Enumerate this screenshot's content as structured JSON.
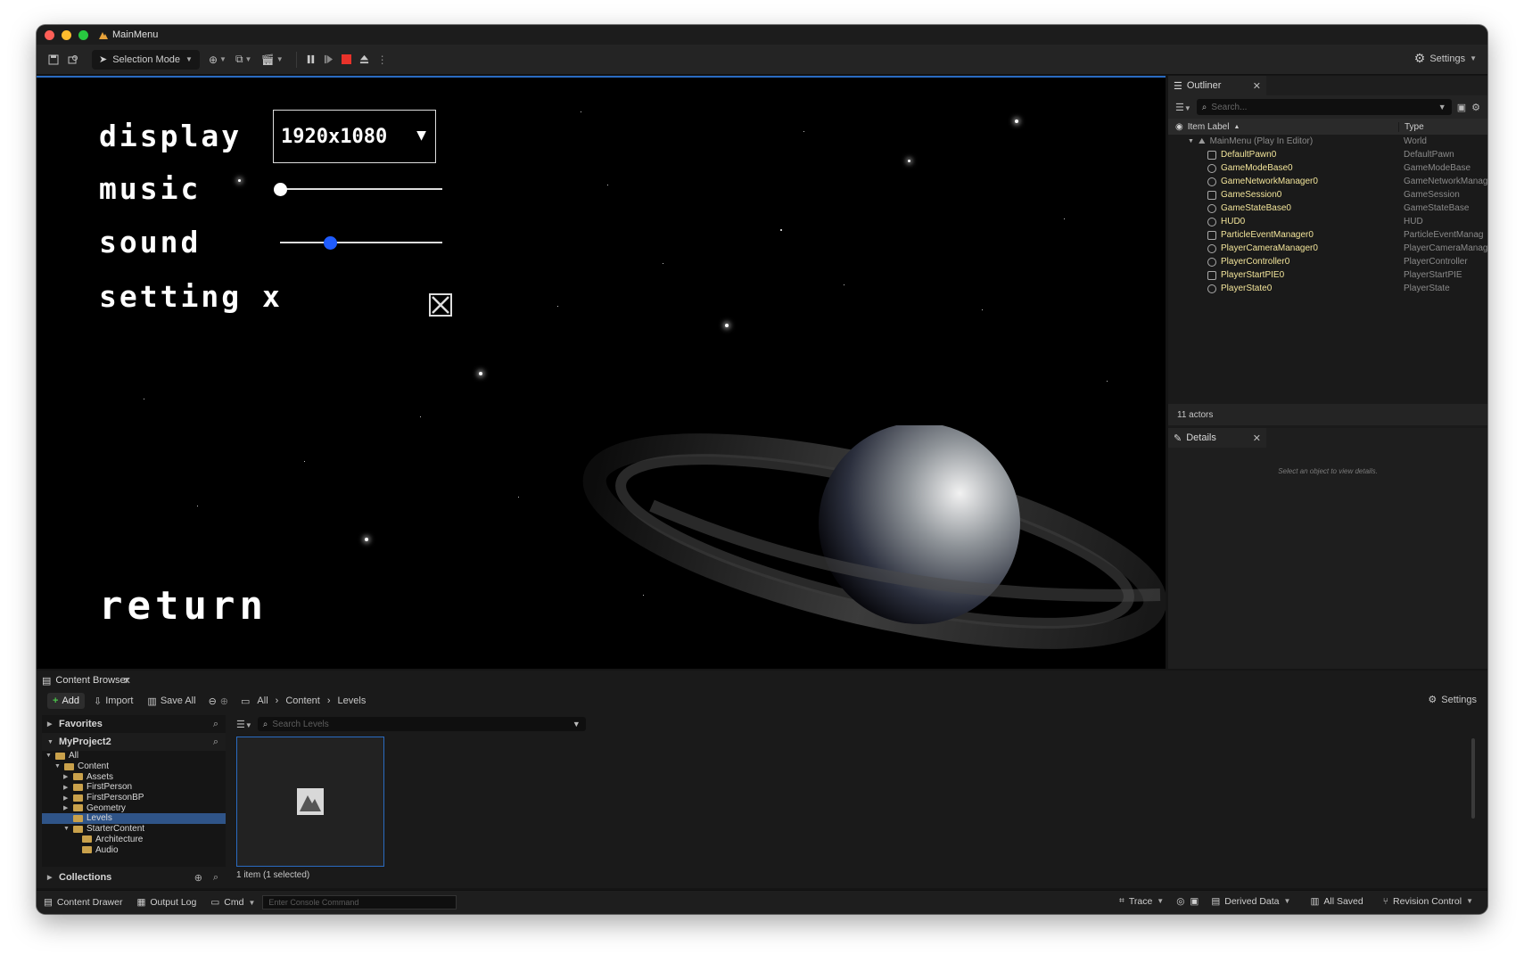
{
  "window": {
    "title": "MainMenu"
  },
  "toolbar": {
    "selection_mode_label": "Selection Mode",
    "settings_label": "Settings"
  },
  "game_menu": {
    "display_label": "display",
    "display_value": "1920x1080",
    "music_label": "music",
    "music_level": 0.0,
    "sound_label": "sound",
    "sound_level": 0.31,
    "setting_x_label": "setting x",
    "setting_x_checked": true,
    "return_label": "return"
  },
  "outliner": {
    "tab_label": "Outliner",
    "search_placeholder": "Search...",
    "col_label": "Item Label",
    "col_type": "Type",
    "world_row": {
      "label": "MainMenu (Play In Editor)",
      "type": "World"
    },
    "rows": [
      {
        "label": "DefaultPawn0",
        "type": "DefaultPawn"
      },
      {
        "label": "GameModeBase0",
        "type": "GameModeBase"
      },
      {
        "label": "GameNetworkManager0",
        "type": "GameNetworkManag"
      },
      {
        "label": "GameSession0",
        "type": "GameSession"
      },
      {
        "label": "GameStateBase0",
        "type": "GameStateBase"
      },
      {
        "label": "HUD0",
        "type": "HUD"
      },
      {
        "label": "ParticleEventManager0",
        "type": "ParticleEventManag"
      },
      {
        "label": "PlayerCameraManager0",
        "type": "PlayerCameraManag"
      },
      {
        "label": "PlayerController0",
        "type": "PlayerController"
      },
      {
        "label": "PlayerStartPIE0",
        "type": "PlayerStartPIE"
      },
      {
        "label": "PlayerState0",
        "type": "PlayerState"
      }
    ],
    "actors_count": "11 actors"
  },
  "details": {
    "tab_label": "Details",
    "hint": "Select an object to view details."
  },
  "content_browser": {
    "tab_label": "Content Browser",
    "add_label": "Add",
    "import_label": "Import",
    "save_all_label": "Save All",
    "breadcrumb": [
      "All",
      "Content",
      "Levels"
    ],
    "settings_label": "Settings",
    "favorites_label": "Favorites",
    "project_label": "MyProject2",
    "tree": [
      {
        "label": "All",
        "depth": 0,
        "open": true
      },
      {
        "label": "Content",
        "depth": 1,
        "open": true
      },
      {
        "label": "Assets",
        "depth": 2,
        "open": false
      },
      {
        "label": "FirstPerson",
        "depth": 2,
        "open": false
      },
      {
        "label": "FirstPersonBP",
        "depth": 2,
        "open": false
      },
      {
        "label": "Geometry",
        "depth": 2,
        "open": false
      },
      {
        "label": "Levels",
        "depth": 2,
        "open": null,
        "selected": true
      },
      {
        "label": "StarterContent",
        "depth": 2,
        "open": true
      },
      {
        "label": "Architecture",
        "depth": 3,
        "open": null
      },
      {
        "label": "Audio",
        "depth": 3,
        "open": null
      }
    ],
    "collections_label": "Collections",
    "search_placeholder": "Search Levels",
    "status": "1 item (1 selected)"
  },
  "statusbar": {
    "content_drawer": "Content Drawer",
    "output_log": "Output Log",
    "cmd": "Cmd",
    "console_placeholder": "Enter Console Command",
    "trace": "Trace",
    "derived_data": "Derived Data",
    "all_saved": "All Saved",
    "revision_control": "Revision Control"
  },
  "colors": {
    "accent_blue": "#2a6bc1",
    "stop_red": "#e8322a",
    "actor_label_yellow": "#f2e49a",
    "sound_thumb_blue": "#1f5cff"
  }
}
